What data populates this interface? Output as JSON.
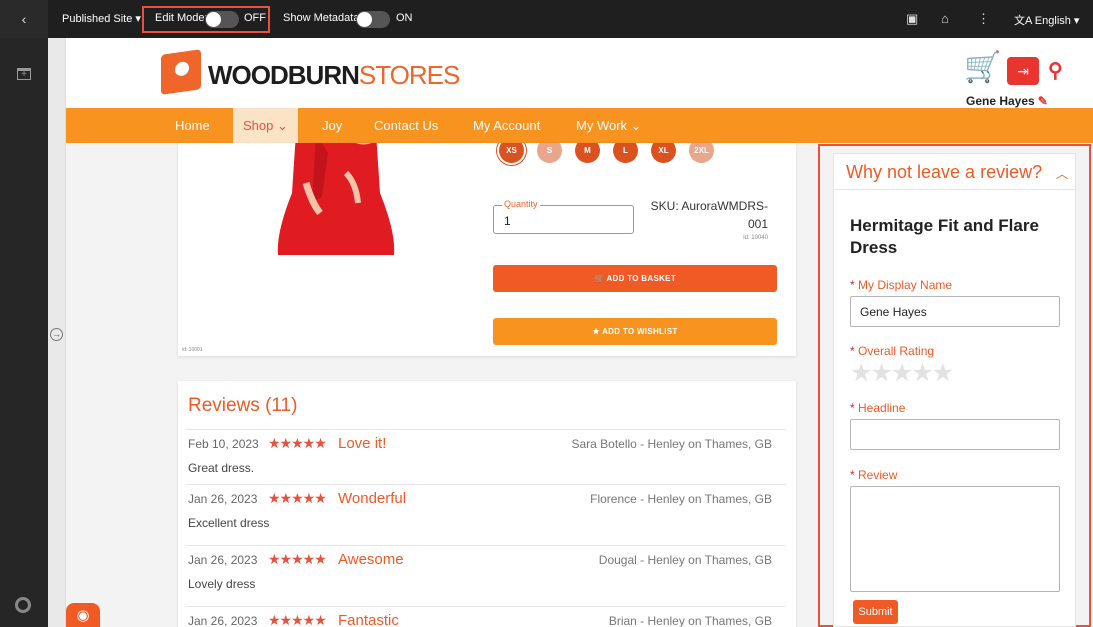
{
  "topbar": {
    "back_icon": "chevron-left-icon",
    "published_site": "Published Site ▾",
    "edit_mode_label": "Edit Mode:",
    "edit_mode_state": "OFF",
    "show_metadata_label": "Show Metadata:",
    "show_metadata_state": "ON",
    "icons": [
      "calendar-icon",
      "home-icon",
      "more-vertical-icon"
    ],
    "language": "English ▾"
  },
  "site": {
    "brand_primary": "WOODBURN",
    "brand_secondary": "STORES",
    "user_name": "Gene Hayes",
    "accent_color": "#f0652a"
  },
  "nav": {
    "items": [
      "Home",
      "Shop ⌄",
      "Joy",
      "Contact Us",
      "My Account",
      "My Work ⌄"
    ]
  },
  "product": {
    "sizes": [
      "XS",
      "S",
      "M",
      "L",
      "XL",
      "2XL"
    ],
    "quantity_label": "Quantity",
    "quantity_value": "1",
    "sku_line1": "SKU: AuroraWMDRS-",
    "sku_line2": "001",
    "sku_id": "id: 10040",
    "add_to_basket": "ADD TO BASKET",
    "add_to_wishlist": "ADD TO WISHLIST",
    "card_id": "id: 10001"
  },
  "reviews": {
    "title": "Reviews (11)",
    "items": [
      {
        "date": "Feb 10, 2023",
        "stars": "★★★★★",
        "headline": "Love it!",
        "author": "Sara Botello - Henley on Thames, GB",
        "body": "Great dress."
      },
      {
        "date": "Jan 26, 2023",
        "stars": "★★★★★",
        "headline": "Wonderful",
        "author": "Florence - Henley on Thames, GB",
        "body": "Excellent dress"
      },
      {
        "date": "Jan 26, 2023",
        "stars": "★★★★★",
        "headline": "Awesome",
        "author": "Dougal - Henley on Thames, GB",
        "body": "Lovely dress"
      },
      {
        "date": "Jan 26, 2023",
        "stars": "★★★★★",
        "headline": "Fantastic",
        "author": "Brian - Henley on Thames, GB",
        "body": ""
      }
    ]
  },
  "review_form": {
    "title": "Why not leave a review?",
    "product_name": "Hermitage Fit and Flare Dress",
    "display_name_label": "My Display Name",
    "display_name_value": "Gene Hayes",
    "rating_label": "Overall Rating",
    "rating_stars": "★★★★★",
    "headline_label": "Headline",
    "headline_value": "",
    "review_label": "Review",
    "required_mark": "*",
    "submit": "Submit"
  }
}
